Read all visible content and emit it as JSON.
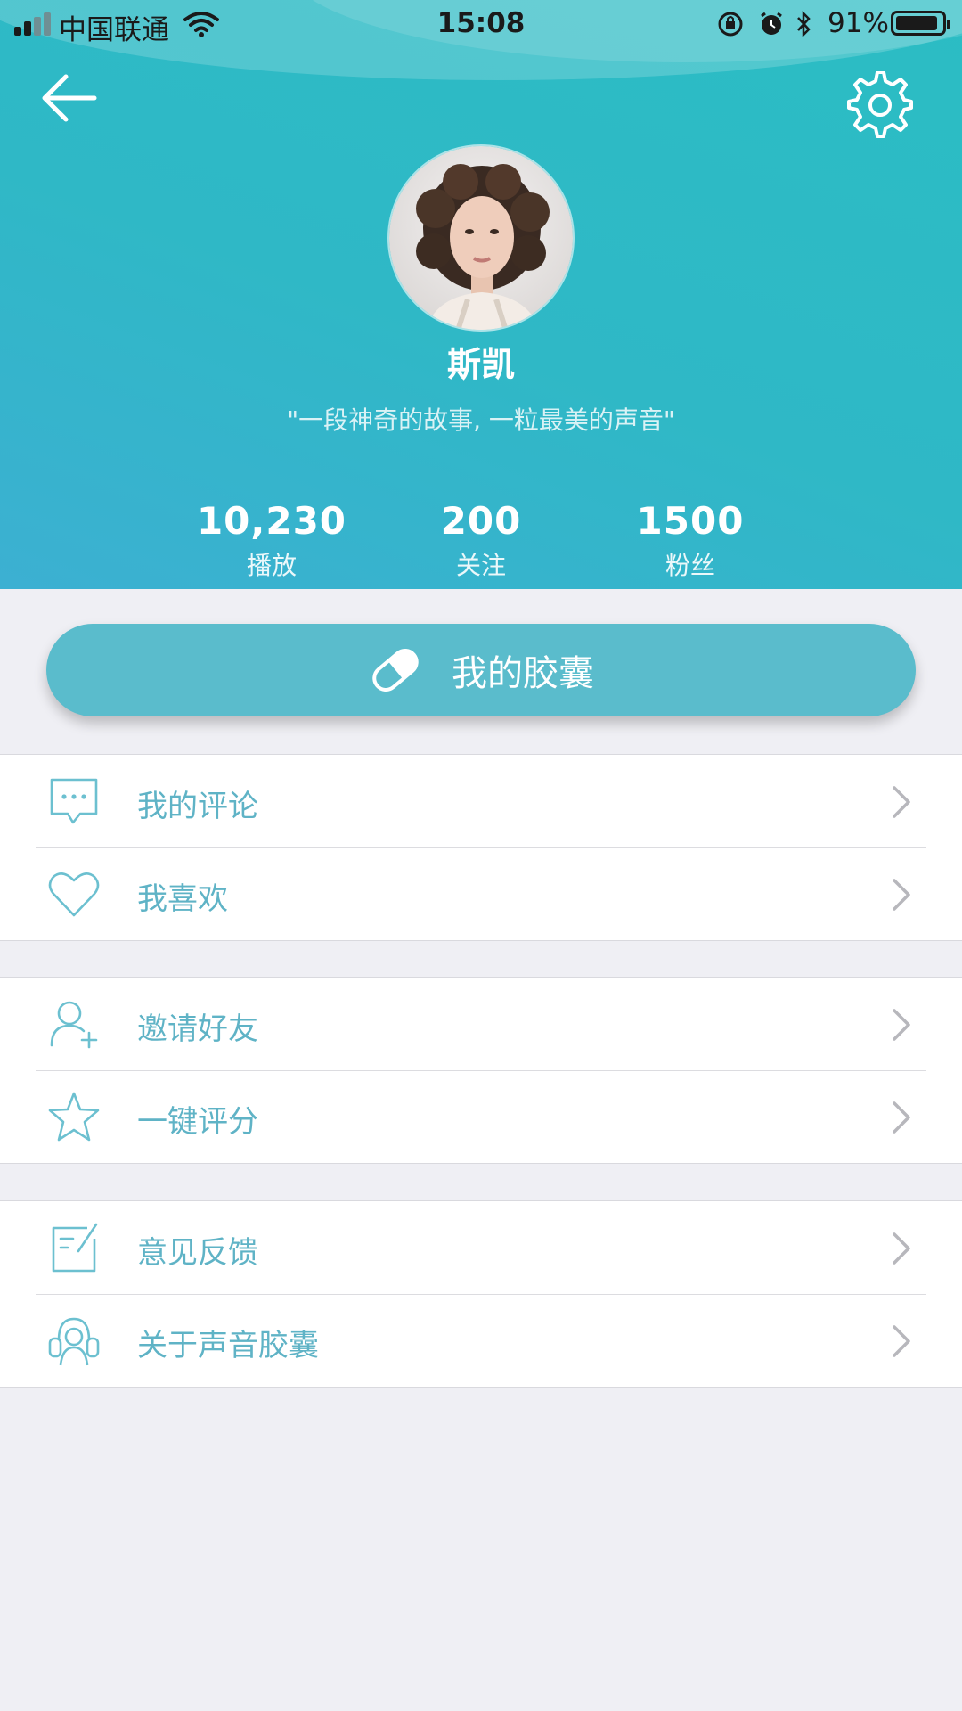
{
  "status_bar": {
    "carrier": "中国联通",
    "time": "15:08",
    "battery_percent": "91%"
  },
  "profile": {
    "name": "斯凯",
    "bio": "\"一段神奇的故事, 一粒最美的声音\"",
    "stats": [
      {
        "value": "10,230",
        "label": "播放"
      },
      {
        "value": "200",
        "label": "关注"
      },
      {
        "value": "1500",
        "label": "粉丝"
      }
    ]
  },
  "capsule_button": {
    "label": "我的胶囊"
  },
  "menu_groups": [
    [
      {
        "label": "我的评论",
        "icon": "comment-icon"
      },
      {
        "label": "我喜欢",
        "icon": "heart-icon"
      }
    ],
    [
      {
        "label": "邀请好友",
        "icon": "add-user-icon"
      },
      {
        "label": "一键评分",
        "icon": "star-icon"
      }
    ],
    [
      {
        "label": "意见反馈",
        "icon": "feedback-icon"
      },
      {
        "label": "关于声音胶囊",
        "icon": "about-icon"
      }
    ]
  ],
  "colors": {
    "header_start": "#2bbdc4",
    "header_end": "#3cb0d2",
    "capsule_button": "#5abccc",
    "menu_text": "#5fb3c6",
    "page_bg": "#efeff4"
  }
}
